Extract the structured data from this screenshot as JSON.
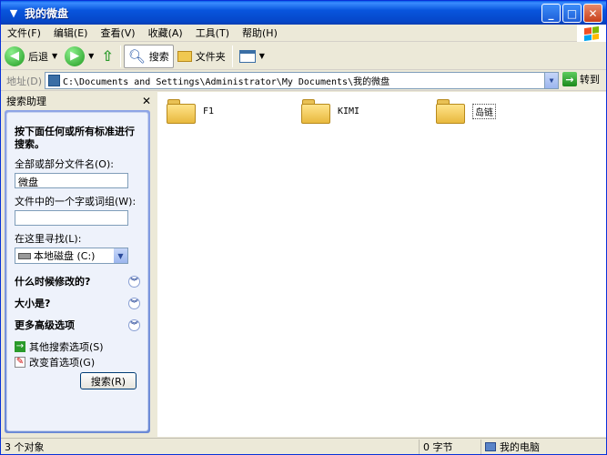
{
  "window": {
    "title": "我的微盘",
    "buttons": [
      "_",
      "□",
      "✕"
    ]
  },
  "menu": [
    "文件(F)",
    "编辑(E)",
    "查看(V)",
    "收藏(A)",
    "工具(T)",
    "帮助(H)"
  ],
  "toolbar": {
    "back_label": "后退",
    "search_label": "搜索",
    "folders_label": "文件夹"
  },
  "address": {
    "label": "地址(D)",
    "path": "C:\\Documents and Settings\\Administrator\\My Documents\\我的微盘",
    "go_label": "转到"
  },
  "search_pane": {
    "title": "搜索助理",
    "heading": "按下面任何或所有标准进行搜索。",
    "filename_label": "全部或部分文件名(O):",
    "filename_value": "微盘",
    "phrase_label": "文件中的一个字或词组(W):",
    "phrase_value": "",
    "lookin_label": "在这里寻找(L):",
    "lookin_value": "本地磁盘 (C:)",
    "sections": [
      "什么时候修改的?",
      "大小是?",
      "更多高级选项"
    ],
    "links": [
      "其他搜索选项(S)",
      "改变首选项(G)"
    ],
    "search_button": "搜索(R)"
  },
  "folders": [
    {
      "name": "F1",
      "selected": false
    },
    {
      "name": "KIMI",
      "selected": false
    },
    {
      "name": "岛链",
      "selected": true
    }
  ],
  "status": {
    "objects": "3 个对象",
    "size": "0 字节",
    "location": "我的电脑"
  },
  "colors": {
    "titlebar": "#0855dd",
    "pane_gradient": "#7b94dc",
    "folder": "#f0c850"
  }
}
